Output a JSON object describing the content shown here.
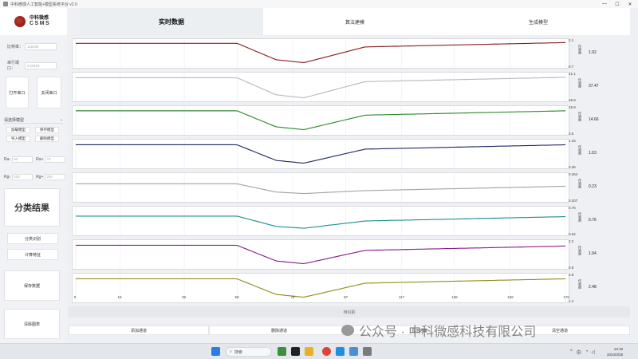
{
  "window": {
    "title": "中科微感人工智能+模型系统平台 v2.0",
    "min": "—",
    "max": "☐",
    "close": "✕"
  },
  "logo": {
    "cn": "中科微感",
    "en": "CSMS"
  },
  "tabs": [
    {
      "label": "实时数据",
      "active": true
    },
    {
      "label": "算法建模",
      "active": false
    },
    {
      "label": "生成模型",
      "active": false
    }
  ],
  "sidebar": {
    "baud_label": "比特率：",
    "baud_value": "115200",
    "port_label": "串行端口：",
    "port_value": "COM19",
    "open_port": "打开串口",
    "close_port": "关闭串口",
    "model_select": "请选择模型",
    "load_model": "加载模型",
    "save_model": "保存模型",
    "import_model": "导入模型",
    "delete_model": "删除模型",
    "ra_label": "Ra-",
    "ra_value": "50",
    "rb_label": "Ra+",
    "rb_value": "70",
    "rg_label": "Rg-",
    "rg_value": "100",
    "rh_label": "Rg+",
    "rh_value": "200",
    "classify_title": "分类结果",
    "classify_btn": "分类识别",
    "calc_btn": "计算特征",
    "save_data": "保存数据",
    "clear_chart": "清除图表"
  },
  "channels": [
    {
      "max": "2.1",
      "min": "0.7",
      "unit": "传感器",
      "value": "1.92",
      "color": "#8b2020",
      "base": 0.08,
      "dip": 0.88,
      "end": 0.05
    },
    {
      "max": "41.1",
      "min": "18.9",
      "unit": "传感器",
      "value": "37.47",
      "color": "#b9b9b9",
      "base": 0.12,
      "dip": 0.95,
      "end": 0.1
    },
    {
      "max": "15.9",
      "min": "3.6",
      "unit": "传感器",
      "value": "14.66",
      "color": "#2e8b2e",
      "base": 0.1,
      "dip": 0.88,
      "end": 0.1
    },
    {
      "max": "1.15",
      "min": "0.35",
      "unit": "传感器",
      "value": "1.03",
      "color": "#232a66",
      "base": 0.12,
      "dip": 0.88,
      "end": 0.12
    },
    {
      "max": "0.264",
      "min": "0.207",
      "unit": "传感器",
      "value": "0.23",
      "color": "#a4a4a4",
      "base": 0.35,
      "dip": 0.75,
      "end": 0.45
    },
    {
      "max": "0.76",
      "min": "0.62",
      "unit": "传感器",
      "value": "0.76",
      "color": "#1f8f8f",
      "base": 0.3,
      "dip": 0.8,
      "end": 0.32
    },
    {
      "max": "2.2",
      "min": "0.9",
      "unit": "传感器",
      "value": "1.94",
      "color": "#8a1f8a",
      "base": 0.12,
      "dip": 0.88,
      "end": 0.15
    },
    {
      "max": "2.8",
      "min": "1.4",
      "unit": "传感器",
      "value": "2.48",
      "color": "#8f8f1f",
      "base": 0.12,
      "dip": 0.88,
      "end": 0.12
    }
  ],
  "xaxis": {
    "ticks": [
      "0",
      "16",
      "39",
      "58",
      "78",
      "97",
      "117",
      "136",
      "156",
      "176"
    ],
    "max": 176
  },
  "status": {
    "text": "待识别"
  },
  "bottom_buttons": [
    "添加通道",
    "删除通道",
    "显示通道",
    "清空通道"
  ],
  "watermark": "公众号 · 中科微感科技有限公司",
  "taskbar": {
    "search": "搜索",
    "time": "13:18",
    "date": "2024/3/28",
    "lang": "中"
  }
}
